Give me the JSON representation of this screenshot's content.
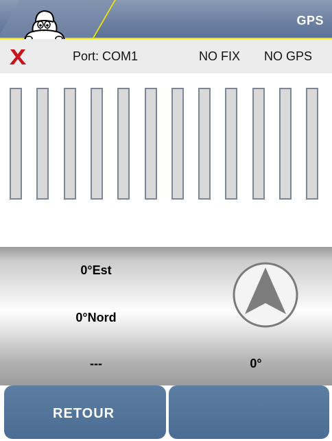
{
  "header": {
    "title": "GPS",
    "logo": "michelin-bibendum-logo"
  },
  "status": {
    "close_icon": "x-icon",
    "close_color": "#c8141e",
    "port": "Port: COM1",
    "fix": "NO FIX",
    "gps": "NO GPS"
  },
  "signal_bars": {
    "count": 12,
    "levels": [
      0,
      0,
      0,
      0,
      0,
      0,
      0,
      0,
      0,
      0,
      0,
      0
    ]
  },
  "info": {
    "longitude": "0°Est",
    "latitude": "0°Nord",
    "altitude": "---",
    "heading": "0°",
    "compass_icon": "compass-arrow-icon"
  },
  "buttons": {
    "back": "RETOUR",
    "right": ""
  }
}
